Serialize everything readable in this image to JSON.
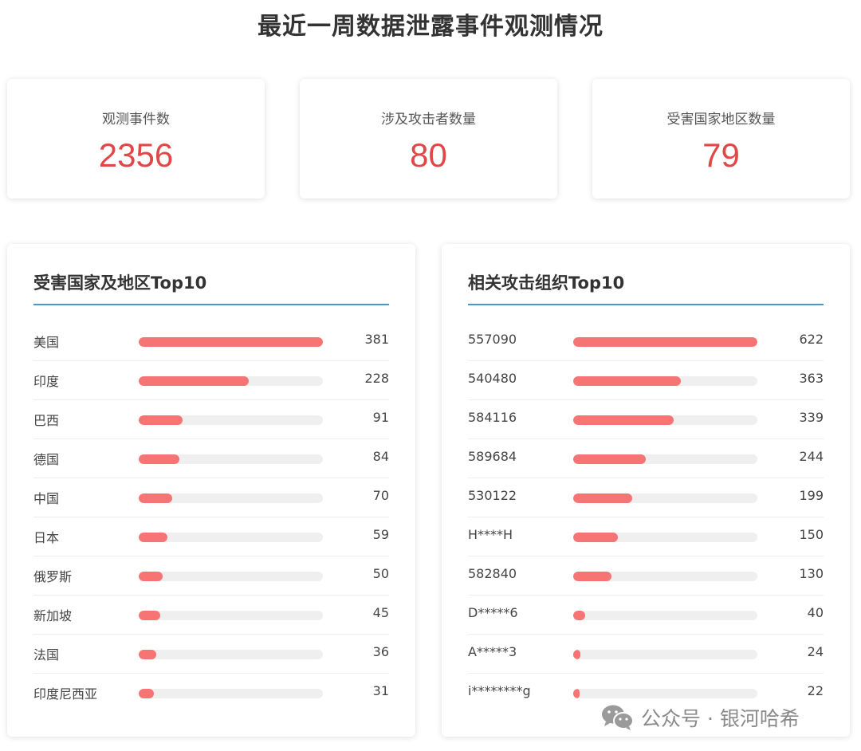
{
  "title": "最近一周数据泄露事件观测情况",
  "stats": [
    {
      "label": "观测事件数",
      "value": "2356"
    },
    {
      "label": "涉及攻击者数量",
      "value": "80"
    },
    {
      "label": "受害国家地区数量",
      "value": "79"
    }
  ],
  "panels": [
    {
      "title": "受害国家及地区Top10",
      "max": 381,
      "rows": [
        {
          "label": "美国",
          "value": 381
        },
        {
          "label": "印度",
          "value": 228
        },
        {
          "label": "巴西",
          "value": 91
        },
        {
          "label": "德国",
          "value": 84
        },
        {
          "label": "中国",
          "value": 70
        },
        {
          "label": "日本",
          "value": 59
        },
        {
          "label": "俄罗斯",
          "value": 50
        },
        {
          "label": "新加坡",
          "value": 45
        },
        {
          "label": "法国",
          "value": 36
        },
        {
          "label": "印度尼西亚",
          "value": 31
        }
      ]
    },
    {
      "title": "相关攻击组织Top10",
      "max": 622,
      "rows": [
        {
          "label": "557090",
          "value": 622
        },
        {
          "label": "540480",
          "value": 363
        },
        {
          "label": "584116",
          "value": 339
        },
        {
          "label": "589684",
          "value": 244
        },
        {
          "label": "530122",
          "value": 199
        },
        {
          "label": "H****H",
          "value": 150
        },
        {
          "label": "582840",
          "value": 130
        },
        {
          "label": "D*****6",
          "value": 40
        },
        {
          "label": "A*****3",
          "value": 24
        },
        {
          "label": "i********g",
          "value": 22
        }
      ]
    }
  ],
  "watermark": {
    "text": "公众号 · 银河哈希",
    "icon": "wechat-icon"
  },
  "colors": {
    "accent": "#e04848",
    "bar": "#f77474",
    "track": "#efefef",
    "underline": "#4a98c8"
  }
}
